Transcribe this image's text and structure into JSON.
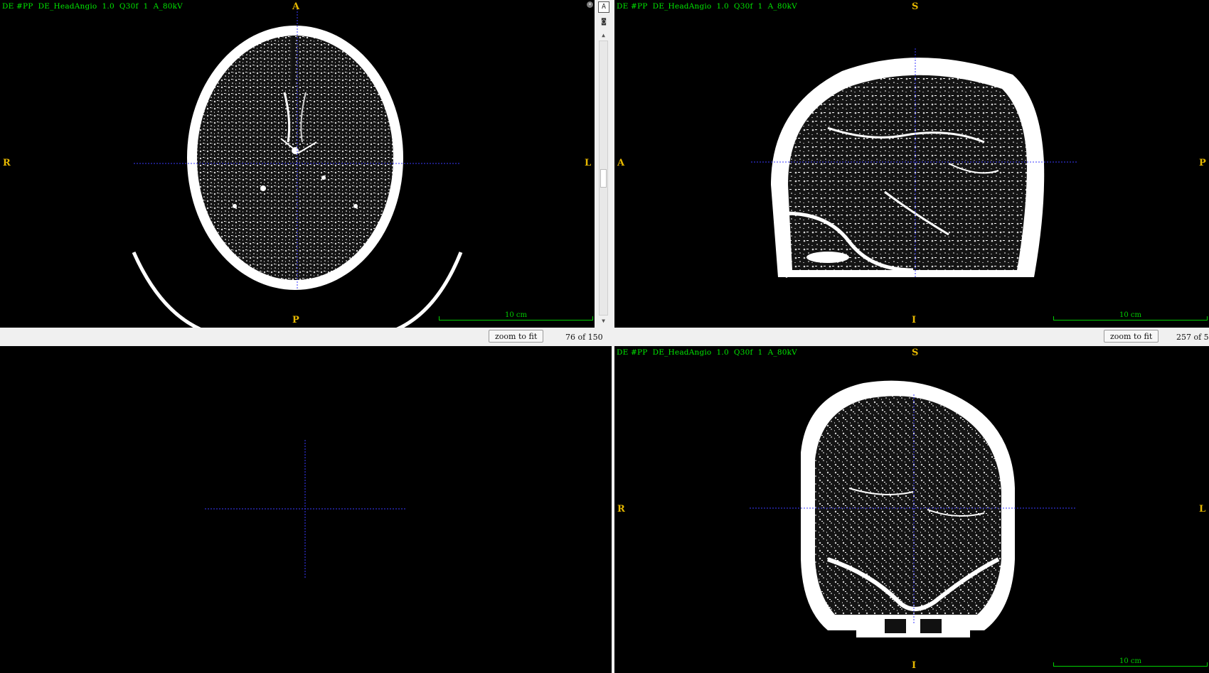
{
  "viewports": {
    "axial": {
      "info": "DE #PP  DE_HeadAngio  1.0  Q30f  1  A_80kV",
      "orient": {
        "top": "A",
        "bottom": "P",
        "left": "R",
        "right": "L"
      },
      "scale_label": "10 cm"
    },
    "sagittal": {
      "info": "DE #PP  DE_HeadAngio  1.0  Q30f  1  A_80kV",
      "orient": {
        "top": "S",
        "bottom": "I",
        "left": "A",
        "right": "P"
      },
      "scale_label": "10 cm"
    },
    "coronal": {
      "info": "DE #PP  DE_HeadAngio  1.0  Q30f  1  A_80kV",
      "orient": {
        "top": "S",
        "bottom": "I",
        "left": "R",
        "right": "L"
      },
      "scale_label": "10 cm"
    }
  },
  "statusbars": {
    "left": {
      "zoom_button": "zoom to fit",
      "slice": "76 of 150"
    },
    "right": {
      "zoom_button": "zoom to fit",
      "slice": "257 of 5"
    }
  },
  "sidebar": {
    "buttons": [
      {
        "icon": "annotation-icon",
        "glyph": "A"
      },
      {
        "icon": "camera-icon",
        "glyph": "◙"
      }
    ],
    "scroll_up": "▲",
    "scroll_down": "▼",
    "chip_glyph": "×"
  },
  "colors": {
    "overlay_text": "#00e600",
    "orientation": "#e6b800",
    "crosshair": "#3a3aff",
    "scale": "#00d000"
  }
}
